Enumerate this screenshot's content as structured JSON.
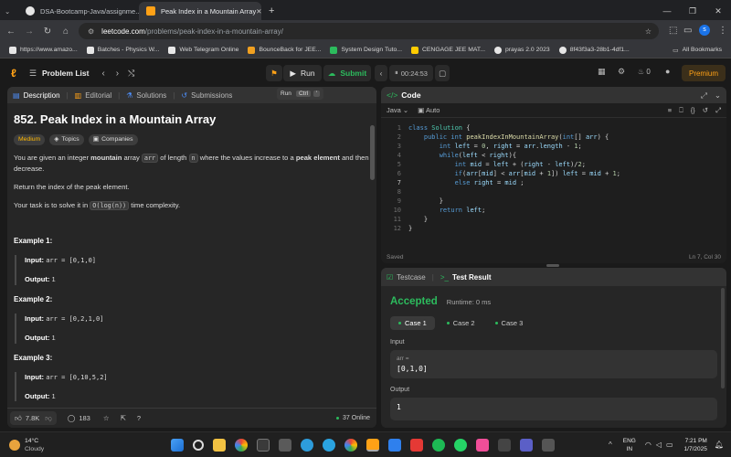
{
  "browser": {
    "tabs": [
      {
        "title": "DSA-Bootcamp-Java/assignme...",
        "fav_color": "#e6e6e6",
        "active": false
      },
      {
        "title": "Peak Index in a Mountain Array",
        "fav_color": "#ffa116",
        "active": true
      }
    ],
    "new_tab_glyph": "+",
    "url_domain": "leetcode.com",
    "url_path": "/problems/peak-index-in-a-mountain-array/",
    "profile_letter": "s",
    "bookmarks": [
      {
        "label": "https://www.amazo...",
        "fav_color": "#e6e6e6"
      },
      {
        "label": "Batches - Physics W...",
        "fav_color": "#e6e6e6"
      },
      {
        "label": "Web Telegram Online",
        "fav_color": "#e8e8e8"
      },
      {
        "label": "BounceBack for JEE...",
        "fav_color": "#f0a020"
      },
      {
        "label": "System Design Tuto...",
        "fav_color": "#2cbb5d"
      },
      {
        "label": "CENGAGE JEE MAT...",
        "fav_color": "#ffcc00"
      },
      {
        "label": "prayas 2.0 2023",
        "fav_color": "#e6e6e6"
      },
      {
        "label": "8f43f3a3-28b1-4df1...",
        "fav_color": "#e6e6e6"
      }
    ],
    "all_bookmarks": "All Bookmarks"
  },
  "lc_nav": {
    "problem_list": "Problem List",
    "run": "Run",
    "submit": "Submit",
    "timer": "00:24:53",
    "streak": "0",
    "premium": "Premium",
    "tooltip_label": "Run",
    "tooltip_key1": "Ctrl",
    "tooltip_key2": "'"
  },
  "left": {
    "tabs": [
      "Description",
      "Editorial",
      "Solutions",
      "Submissions"
    ],
    "title": "852. Peak Index in a Mountain Array",
    "difficulty": "Medium",
    "tag_topics": "Topics",
    "tag_companies": "Companies",
    "p1_a": "You are given an integer ",
    "p1_b": "mountain",
    "p1_c": " array ",
    "p1_code1": "arr",
    "p1_d": " of length ",
    "p1_code2": "n",
    "p1_e": " where the values increase to a ",
    "p1_f": "peak element",
    "p1_g": " and then decrease.",
    "p2": "Return the index of the peak element.",
    "p3_a": "Your task is to solve it in ",
    "p3_code": "O(log(n))",
    "p3_b": " time complexity.",
    "examples": [
      {
        "heading": "Example 1:",
        "input_label": "Input:",
        "input": "arr = [0,1,0]",
        "output_label": "Output:",
        "output": "1"
      },
      {
        "heading": "Example 2:",
        "input_label": "Input:",
        "input": "arr = [0,2,1,0]",
        "output_label": "Output:",
        "output": "1"
      },
      {
        "heading": "Example 3:",
        "input_label": "Input:",
        "input": "arr = [0,10,5,2]",
        "output_label": "Output:",
        "output": "1"
      }
    ],
    "likes": "7.8K",
    "comments": "183",
    "online": "37 Online"
  },
  "code": {
    "header": "Code",
    "language": "Java",
    "auto": "Auto",
    "line_numbers": [
      "1",
      "2",
      "3",
      "4",
      "5",
      "6",
      "7",
      "8",
      "9",
      "10",
      "11",
      "12"
    ],
    "saved": "Saved",
    "cursor": "Ln 7, Col 30"
  },
  "test": {
    "tab_testcase": "Testcase",
    "tab_result": "Test Result",
    "status": "Accepted",
    "runtime": "Runtime: 0 ms",
    "cases": [
      "Case 1",
      "Case 2",
      "Case 3"
    ],
    "input_label": "Input",
    "var_name": "arr =",
    "var_value": "[0,1,0]",
    "output_label": "Output",
    "output_value": "1"
  },
  "taskbar": {
    "temp": "14°C",
    "weather": "Cloudy",
    "lang_1": "ENG",
    "lang_2": "IN",
    "time": "7:21 PM",
    "date": "1/7/2025"
  }
}
